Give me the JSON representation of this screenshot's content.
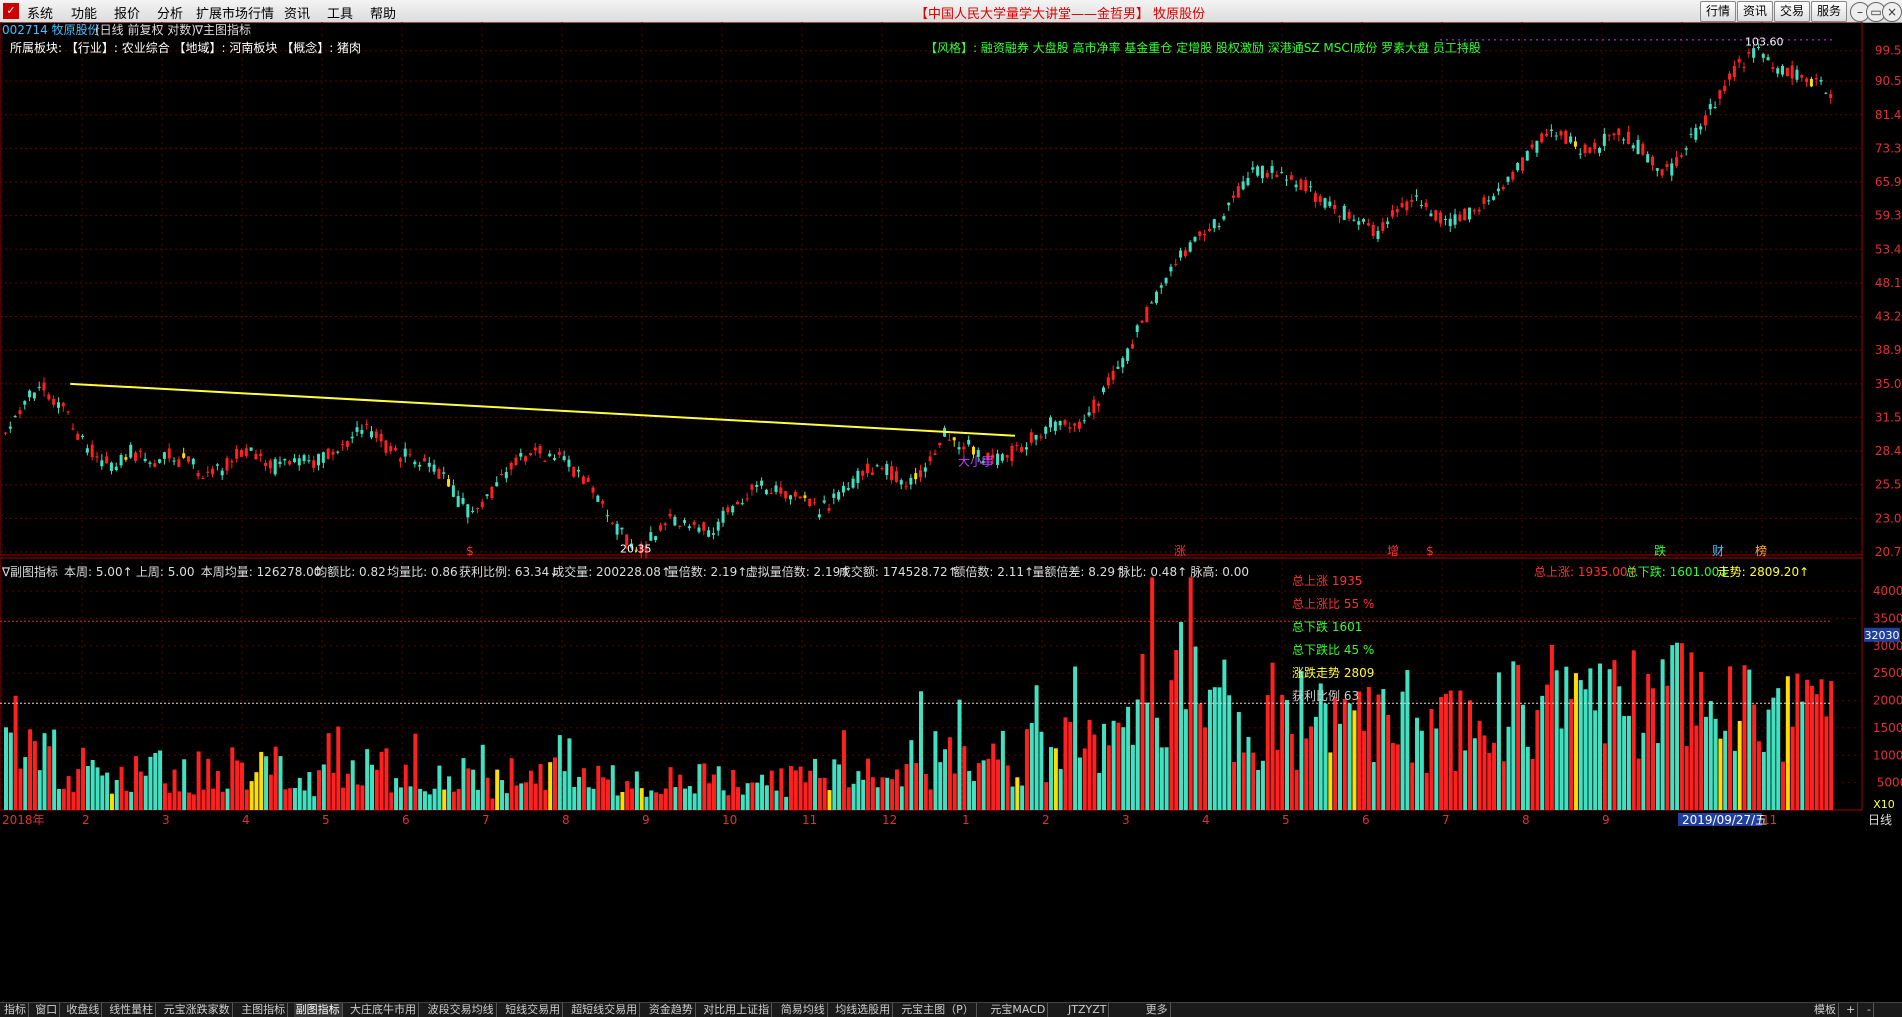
{
  "menu": {
    "items": [
      "系统",
      "功能",
      "报价",
      "分析",
      "扩展市场行情",
      "资讯",
      "工具",
      "帮助"
    ],
    "center_title": "【中国人民大学量学大讲堂——金哲男】 牧原股份",
    "right_buttons": [
      "行情",
      "资讯",
      "交易",
      "服务"
    ]
  },
  "header": {
    "stock": "002714 牧原股份",
    "mode": "(日线 前复权 对数)",
    "indicator": "∇主图指标",
    "sector_line": "所属板块: 【行业】: 农业综合 【地域】: 河南板块 【概念】: 猪肉",
    "style_tags": "【风格】: 融资融券 大盘股 高市净率 基金重仓 定增股 股权激励 深港通SZ MSCI成份 罗素大盘 员工持股"
  },
  "price_axis": [
    "99.55",
    "90.50",
    "81.45",
    "73.30",
    "65.97",
    "59.38",
    "53.44",
    "48.10",
    "43.29",
    "38.96",
    "35.06",
    "31.56",
    "28.40",
    "25.56",
    "23.00",
    "20.70"
  ],
  "annotations": {
    "high": "103.60",
    "low": "20.35",
    "pattern": "大小事",
    "markers": [
      "$",
      "涨",
      "增",
      "$",
      "跌",
      "财",
      "榜"
    ]
  },
  "sub_header": {
    "title": "∇副图指标",
    "fields": [
      {
        "label": "本周:",
        "value": "5.00",
        "arrow": "↑",
        "color": "#fff"
      },
      {
        "label": "上周:",
        "value": "5.00",
        "arrow": "",
        "color": "#fff"
      },
      {
        "label": "本周均量:",
        "value": "126278.00",
        "arrow": "",
        "color": "#fff"
      },
      {
        "label": "均额比:",
        "value": "0.82",
        "arrow": "",
        "color": "#fff"
      },
      {
        "label": "均量比:",
        "value": "0.86",
        "arrow": "",
        "color": "#fff"
      },
      {
        "label": "获利比例:",
        "value": "63.34",
        "arrow": "↓",
        "color": "#fff"
      },
      {
        "label": "成交量:",
        "value": "200228.08",
        "arrow": "↑",
        "color": "#fff"
      },
      {
        "label": "量倍数:",
        "value": "2.19",
        "arrow": "↑",
        "color": "#fff"
      },
      {
        "label": "虚拟量倍数:",
        "value": "2.19",
        "arrow": "↑",
        "color": "#fff"
      },
      {
        "label": "成交额:",
        "value": "174528.72",
        "arrow": "↑",
        "color": "#fff"
      },
      {
        "label": "额倍数:",
        "value": "2.11",
        "arrow": "↑",
        "color": "#fff"
      },
      {
        "label": "量额倍差:",
        "value": "8.29",
        "arrow": "↑",
        "color": "#fff"
      },
      {
        "label": "脉比:",
        "value": "0.48",
        "arrow": "↑",
        "color": "#fff"
      },
      {
        "label": "脉高:",
        "value": "0.00",
        "arrow": "",
        "color": "#fff"
      }
    ],
    "right_stats": [
      {
        "text": "总上涨: 1935.00",
        "arrow": "↑",
        "color": "#ff3030"
      },
      {
        "text": "总下跌: 1601.00",
        "arrow": "↓",
        "color": "#30ff30"
      },
      {
        "text": "走势: 2809.20",
        "arrow": "↑",
        "color": "#ffff30"
      }
    ]
  },
  "legend": [
    {
      "text": "总上涨 1935",
      "color": "#ff3030"
    },
    {
      "text": "总上涨比 55 %",
      "color": "#ff3030"
    },
    {
      "text": "总下跌 1601",
      "color": "#30ff30"
    },
    {
      "text": "总下跌比 45 %",
      "color": "#30ff30"
    },
    {
      "text": "涨跌走势 2809",
      "color": "#ffff30"
    },
    {
      "text": "获利比例 63",
      "color": "#cccccc"
    }
  ],
  "volume_axis": [
    "40000",
    "35000",
    "30000",
    "25000",
    "20000",
    "15000",
    "10000",
    "5000"
  ],
  "volume_axis_highlight": "32030",
  "volume_unit": "X10",
  "time_axis": [
    "2018年",
    "2",
    "3",
    "4",
    "5",
    "6",
    "7",
    "8",
    "9",
    "10",
    "11",
    "12",
    "1",
    "2",
    "3",
    "4",
    "5",
    "6",
    "7",
    "8",
    "9",
    "2019/09/27/五",
    "11"
  ],
  "period_label": "日线",
  "bottom_tabs": [
    "指标",
    "窗口",
    "收盘线",
    "线性量柱",
    "元宝涨跌家数",
    "主图指标",
    "副图指标",
    "大庄底牛市用",
    "波段交易均线",
    "短线交易用",
    "超短线交易用",
    "资金趋势",
    "对比用上证指",
    "简易均线",
    "均线选股用",
    "元宝主图（P）",
    "元宝MACD",
    "JTZYZT",
    "更多"
  ],
  "bottom_right": [
    "模板",
    "+",
    "-"
  ],
  "chart_data": {
    "type": "candlestick",
    "description_ref": "daily candles 2018-01 to 2019-10, log scale",
    "y_scale": "log",
    "ylim": [
      20.7,
      103.6
    ],
    "trendline": {
      "from_price": 35.06,
      "to_price": 29.8,
      "color": "#ffff40"
    },
    "price_path": [
      30,
      33,
      35,
      33,
      30,
      28,
      27,
      28.5,
      27,
      28,
      27.5,
      26.5,
      27,
      28.5,
      28,
      27,
      28,
      27,
      28.5,
      29.5,
      30.5,
      29,
      28,
      27.5,
      26.5,
      24.5,
      23,
      25,
      27,
      28.5,
      28,
      27.5,
      26,
      24.5,
      22,
      20.5,
      22,
      23,
      22.5,
      22,
      23.5,
      25,
      25.5,
      25,
      24.5,
      23.5,
      24.5,
      26,
      27,
      26.5,
      25.5,
      27.5,
      30,
      29,
      28,
      27.5,
      28.5,
      30,
      31,
      30.5,
      32,
      35,
      38,
      43,
      47,
      52,
      55,
      58,
      63,
      68,
      68.5,
      67,
      65,
      62,
      60,
      58,
      56,
      60,
      62,
      60,
      58,
      60,
      62,
      65,
      70,
      75,
      77,
      74,
      73,
      78,
      75,
      71,
      68,
      73,
      80,
      88,
      96,
      100,
      95,
      93,
      90,
      88
    ],
    "volume_path": [
      15000,
      12000,
      10000,
      9000,
      8000,
      7500,
      7000,
      7500,
      8000,
      7000,
      6500,
      7000,
      7500,
      8000,
      7000,
      7500,
      7000,
      6500,
      6000,
      7000,
      7500,
      8000,
      7000,
      6500,
      6000,
      5500,
      6000,
      5500,
      5000,
      6500,
      7000,
      6500,
      6000,
      5500,
      5000,
      5500,
      5000,
      4500,
      5000,
      5500,
      6000,
      6500,
      6000,
      5500,
      5000,
      5500,
      6000,
      7000,
      6500,
      6000,
      6500,
      8000,
      10000,
      9000,
      9500,
      8500,
      9000,
      9500,
      10000,
      10500,
      11000,
      12000,
      13000,
      15000,
      17000,
      19000,
      21000,
      22000,
      20000,
      19000,
      18000,
      17500,
      18000,
      17000,
      16500,
      16000,
      16500,
      17000,
      18000,
      17500,
      17000,
      16500,
      16000,
      17000,
      18000,
      19000,
      20000,
      19500,
      19000,
      18500,
      18000,
      19000,
      20000,
      21000,
      22000,
      21000,
      20000,
      19000,
      18000,
      17500,
      17000,
      16500,
      16000,
      15500,
      15000
    ],
    "colors": {
      "up": "#ff2020",
      "down": "#40e0c0",
      "highlight": "#ffdd00"
    },
    "volume_levels": [
      {
        "value": 34500,
        "color": "#d03030",
        "style": "dotted"
      },
      {
        "value": 19500,
        "color": "#dddddd",
        "style": "dotted"
      }
    ]
  }
}
